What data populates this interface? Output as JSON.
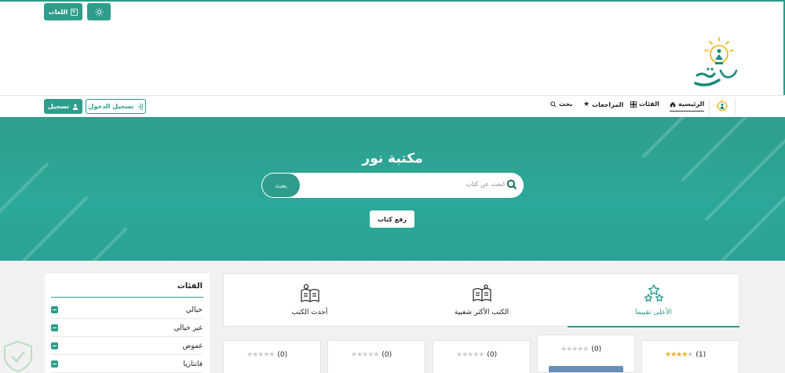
{
  "header": {
    "languages_label": "اللغات",
    "logo_text": "مكتبة نور"
  },
  "nav": {
    "items": [
      {
        "label": "الرئيسية",
        "icon": "home-icon",
        "active": true
      },
      {
        "label": "الفئات",
        "icon": "grid-icon",
        "active": false
      },
      {
        "label": "المراجعات",
        "icon": "star-icon",
        "active": false
      },
      {
        "label": "بحث",
        "icon": "search-icon",
        "active": false
      }
    ],
    "login_label": "تسجيل الدخول",
    "signup_label": "تسجيل"
  },
  "hero": {
    "title": "مكتبة نور",
    "search_placeholder": "ابحث عن كتاب",
    "search_button": "بحث",
    "upload_button": "رفع كتاب"
  },
  "sidebar": {
    "title": "الفئات",
    "categories": [
      "خيالي",
      "غير خيالي",
      "غموض",
      "فانتازيا"
    ]
  },
  "tabs": [
    {
      "label": "الأعلى تقييما",
      "icon": "stars-icon",
      "active": true
    },
    {
      "label": "الكتب الأكثر شعبية",
      "icon": "open-book-icon",
      "active": false
    },
    {
      "label": "أحدث الكتب",
      "icon": "new-book-icon",
      "active": false
    }
  ],
  "books": [
    {
      "rating_count": "(1)",
      "stars": 4,
      "cover_color": "#3b5a2c"
    },
    {
      "rating_count": "(0)",
      "stars": 0,
      "cover_color": "#6a8fb8"
    },
    {
      "rating_count": "(0)",
      "stars": 0,
      "cover_color": "#e05a4a"
    },
    {
      "rating_count": "(0)",
      "stars": 0,
      "cover_color": "#b58a4a"
    },
    {
      "rating_count": "(0)",
      "stars": 0,
      "cover_color": "#1d2a4a"
    }
  ],
  "colors": {
    "primary": "#2e9d8b",
    "accent_yellow": "#f0b400"
  }
}
